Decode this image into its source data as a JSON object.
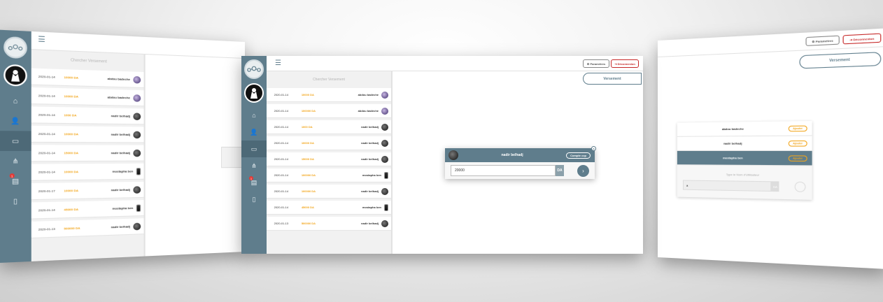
{
  "main": {
    "search_placeholder": "Chercher Versement",
    "parametres_label": "Paramètres",
    "deconnexion_label": "Déconnexion",
    "versement_button": "Versement",
    "badge_count": "1",
    "rows": [
      {
        "date": "2020-01-14",
        "amount": "10000 DA",
        "name": "abdou badeche",
        "avatar": "purple"
      },
      {
        "date": "2020-01-14",
        "amount": "100000 DA",
        "name": "abdou badeche",
        "avatar": "purple"
      },
      {
        "date": "2020-01-14",
        "amount": "1000 DA",
        "name": "nadir belhadj",
        "avatar": "dark"
      },
      {
        "date": "2020-01-14",
        "amount": "10000 DA",
        "name": "nadir belhadj",
        "avatar": "dark"
      },
      {
        "date": "2020-01-14",
        "amount": "15000 DA",
        "name": "nadir belhadj",
        "avatar": "dark"
      },
      {
        "date": "2020-01-14",
        "amount": "100000 DA",
        "name": "mostapha ben",
        "avatar": "phone"
      },
      {
        "date": "2020-01-14",
        "amount": "100000 DA",
        "name": "nadir belhadj",
        "avatar": "dark"
      },
      {
        "date": "2020-01-14",
        "amount": "45000 DA",
        "name": "mostapha ben",
        "avatar": "phone"
      },
      {
        "date": "2020-01-13",
        "amount": "500000 DA",
        "name": "nadir belhadj",
        "avatar": "dark"
      }
    ],
    "modal": {
      "name": "nadir belhadj",
      "pill": "Compte ccp",
      "close": "x",
      "amount_value": "20000",
      "unit": "DA",
      "go_icon": "›"
    }
  },
  "left": {
    "search_placeholder": "Chercher Versement",
    "badge_count": "1",
    "rows": [
      {
        "date": "2020-01-14",
        "amount": "10000 DA",
        "name": "abdou badeche",
        "avatar": "purple"
      },
      {
        "date": "2020-01-14",
        "amount": "10000 DA",
        "name": "abdou badeche",
        "avatar": "purple"
      },
      {
        "date": "2020-01-14",
        "amount": "1000 DA",
        "name": "nadir belhadj",
        "avatar": "dark"
      },
      {
        "date": "2020-01-14",
        "amount": "10000 DA",
        "name": "nadir belhadj",
        "avatar": "dark"
      },
      {
        "date": "2020-01-14",
        "amount": "15000 DA",
        "name": "nadir belhadj",
        "avatar": "dark"
      },
      {
        "date": "2020-01-14",
        "amount": "10000 DA",
        "name": "mostapha ben",
        "avatar": "phone"
      },
      {
        "date": "2020-01-17",
        "amount": "10000 DA",
        "name": "nadir belhadj",
        "avatar": "dark"
      },
      {
        "date": "2020-01-14",
        "amount": "45000 DA",
        "name": "mostapha ben",
        "avatar": "phone"
      },
      {
        "date": "2020-01-13",
        "amount": "500000 DA",
        "name": "nadir belhadj",
        "avatar": "dark"
      }
    ]
  },
  "right": {
    "parametres_label": "Paramètres",
    "deconnexion_label": "Déconnexion",
    "versement_button": "Versement",
    "users": [
      {
        "name": "abdou badeche",
        "pill": "Ajouter",
        "avatar": "purple",
        "selected": false
      },
      {
        "name": "nadir belhadj",
        "pill": "Ajouter",
        "avatar": "dark",
        "selected": false
      },
      {
        "name": "mostapha ben",
        "pill": "Ajouter",
        "avatar": "phone",
        "selected": true
      }
    ],
    "type_hint": "Type le Nom d'Utilisateur",
    "input_value": "a",
    "unit": "DA"
  },
  "colors": {
    "sidebar": "#5f7d8c",
    "amount": "#f2a51a",
    "danger": "#c62828"
  },
  "icons": [
    "logo-icon",
    "hamburger-icon",
    "home-icon",
    "user-edit-icon",
    "card-icon",
    "network-icon",
    "document-icon",
    "file-icon",
    "chevron-right-icon"
  ]
}
